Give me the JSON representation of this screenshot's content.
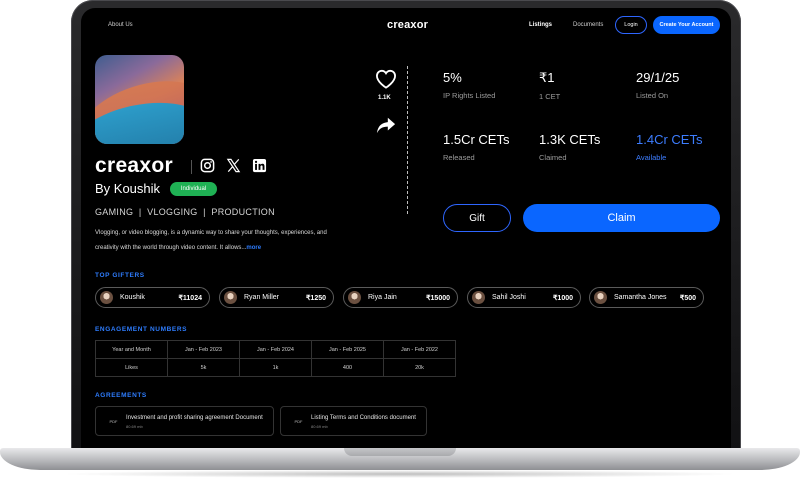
{
  "nav": {
    "about": "About Us",
    "logo": "creaxor",
    "listings": "Listings",
    "documents": "Documents",
    "login": "Login",
    "create_account": "Create Your Account"
  },
  "profile": {
    "title": "creaxor",
    "by": "By Koushik",
    "badge": "Individual",
    "tags": "GAMING  |  VLOGGING  |  PRODUCTION",
    "description": "Vlogging, or video blogging, is a dynamic way to share your thoughts, experiences, and creativity with the world through video content. It allows...",
    "more": "more",
    "social_icons": [
      "instagram-icon",
      "x-icon",
      "linkedin-icon"
    ]
  },
  "actions": {
    "like_count": "1.1K"
  },
  "stats": [
    {
      "value": "5%",
      "label": "IP Rights Listed",
      "highlight": false
    },
    {
      "value": "₹1",
      "label": "1 CET",
      "highlight": false
    },
    {
      "value": "29/1/25",
      "label": "Listed On",
      "highlight": false
    },
    {
      "value": "1.5Cr CETs",
      "label": "Released",
      "highlight": false
    },
    {
      "value": "1.3K CETs",
      "label": "Claimed",
      "highlight": false
    },
    {
      "value": "1.4Cr CETs",
      "label": "Available",
      "highlight": true
    }
  ],
  "buttons": {
    "gift": "Gift",
    "claim": "Claim"
  },
  "top_gifters": {
    "heading": "TOP GIFTERS",
    "items": [
      {
        "name": "Koushik",
        "amount": "₹11024"
      },
      {
        "name": "Ryan Miller",
        "amount": "₹1250"
      },
      {
        "name": "Riya Jain",
        "amount": "₹15000"
      },
      {
        "name": "Sahil Joshi",
        "amount": "₹1000"
      },
      {
        "name": "Samantha Jones",
        "amount": "₹500"
      }
    ]
  },
  "engagement": {
    "heading": "ENGAGEMENT NUMBERS",
    "header": [
      "Year and Month",
      "Jan - Feb 2023",
      "Jan - Feb 2024",
      "Jan - Feb 2025",
      "Jan - Feb 2022"
    ],
    "row": [
      "Likes",
      "5k",
      "1k",
      "400",
      "20k"
    ]
  },
  "agreements": {
    "heading": "AGREEMENTS",
    "items": [
      {
        "title": "Investment and profit sharing agreement Document",
        "size": "80.69 mb",
        "icon_label": "PDF"
      },
      {
        "title": "Listing Terms and Conditions document",
        "size": "80.69 mb",
        "icon_label": "PDF"
      }
    ]
  },
  "colors": {
    "accent": "#0a66ff",
    "badge": "#1fb154",
    "background": "#000000"
  }
}
